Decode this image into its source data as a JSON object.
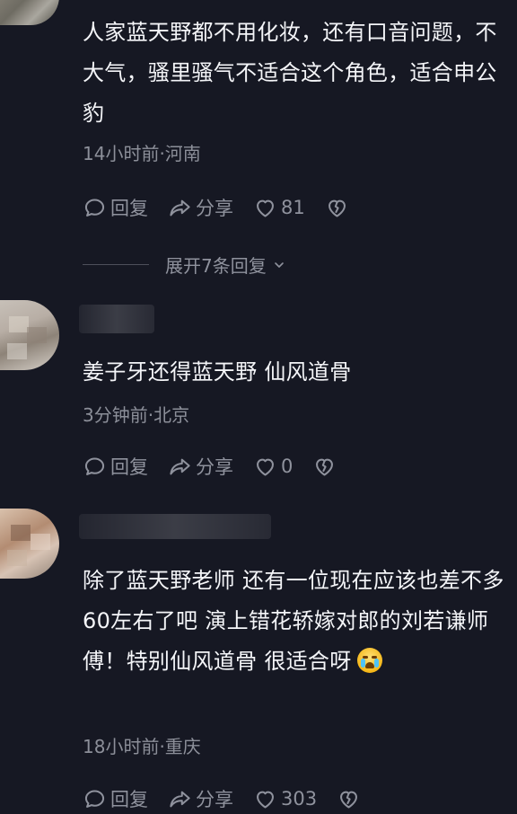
{
  "comments": [
    {
      "text": "人家蓝天野都不用化妆，还有口音问题，不大气，骚里骚气不适合这个角色，适合申公豹",
      "meta": "14小时前·河南",
      "reply_label": "回复",
      "share_label": "分享",
      "like_count": "81"
    },
    {
      "text": "姜子牙还得蓝天野 仙风道骨",
      "meta": "3分钟前·北京",
      "reply_label": "回复",
      "share_label": "分享",
      "like_count": "0"
    },
    {
      "text": "除了蓝天野老师 还有一位现在应该也差不多60左右了吧 演上错花轿嫁对郎的刘若谦师傅！特别仙风道骨 很适合呀",
      "meta": "18小时前·重庆",
      "reply_label": "回复",
      "share_label": "分享",
      "like_count": "303"
    }
  ],
  "expand": {
    "label": "展开7条回复"
  },
  "icons": {
    "reply": "comment-bubble-icon",
    "share": "share-arrow-icon",
    "like": "heart-outline-icon",
    "dislike": "broken-heart-icon",
    "expand": "chevron-down-icon",
    "emoji": "crying-face-emoji"
  },
  "colors": {
    "background": "#161823",
    "text": "#f4f5f8",
    "secondary": "#8c8f99"
  }
}
